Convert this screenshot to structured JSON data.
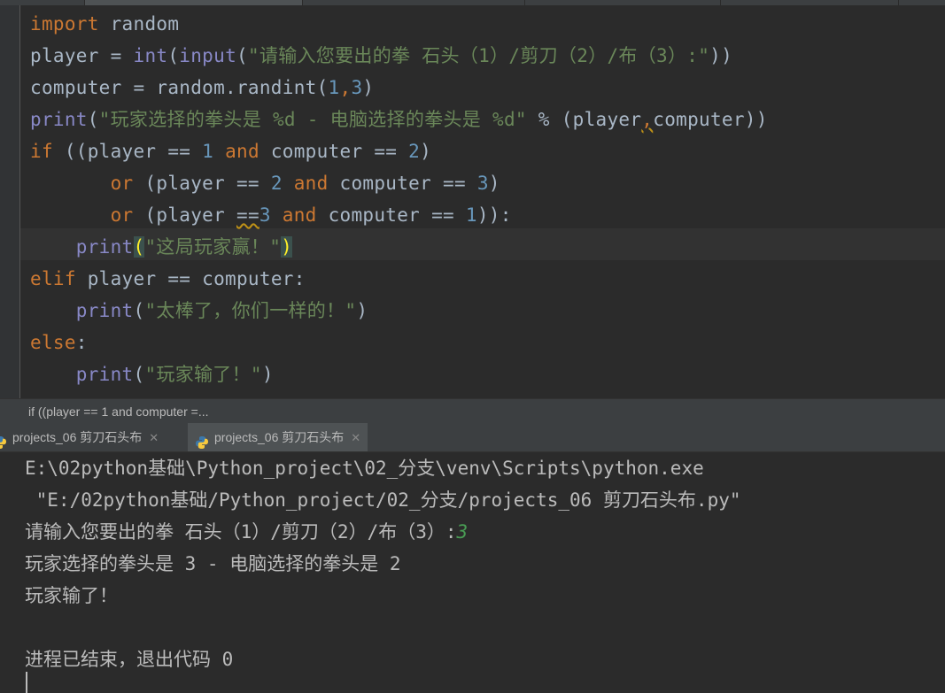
{
  "editor": {
    "lines": [
      {
        "tokens": [
          {
            "t": "import",
            "c": "kw"
          },
          {
            "t": " random",
            "c": "plain"
          }
        ]
      },
      {
        "tokens": [
          {
            "t": "player = ",
            "c": "plain"
          },
          {
            "t": "int",
            "c": "fn"
          },
          {
            "t": "(",
            "c": "plain"
          },
          {
            "t": "input",
            "c": "fn"
          },
          {
            "t": "(",
            "c": "plain"
          },
          {
            "t": "\"请输入您要出的拳 石头（1）/剪刀（2）/布（3）:\"",
            "c": "str"
          },
          {
            "t": "))",
            "c": "plain"
          }
        ]
      },
      {
        "tokens": [
          {
            "t": "computer = random.randint(",
            "c": "plain"
          },
          {
            "t": "1",
            "c": "num"
          },
          {
            "t": ",",
            "c": "kw"
          },
          {
            "t": "3",
            "c": "num"
          },
          {
            "t": ")",
            "c": "plain"
          }
        ]
      },
      {
        "tokens": [
          {
            "t": "print",
            "c": "fn"
          },
          {
            "t": "(",
            "c": "plain"
          },
          {
            "t": "\"玩家选择的拳头是 %d - 电脑选择的拳头是 %d\"",
            "c": "str"
          },
          {
            "t": " % (player",
            "c": "plain"
          },
          {
            "t": ",",
            "c": "kw warn"
          },
          {
            "t": "computer))",
            "c": "plain"
          }
        ]
      },
      {
        "tokens": [
          {
            "t": "if",
            "c": "kw"
          },
          {
            "t": " ((player == ",
            "c": "plain"
          },
          {
            "t": "1",
            "c": "num"
          },
          {
            "t": " ",
            "c": "plain"
          },
          {
            "t": "and",
            "c": "kw"
          },
          {
            "t": " computer == ",
            "c": "plain"
          },
          {
            "t": "2",
            "c": "num"
          },
          {
            "t": ")",
            "c": "plain"
          }
        ]
      },
      {
        "tokens": [
          {
            "t": "       ",
            "c": "plain"
          },
          {
            "t": "or",
            "c": "kw"
          },
          {
            "t": " (player == ",
            "c": "plain"
          },
          {
            "t": "2",
            "c": "num"
          },
          {
            "t": " ",
            "c": "plain"
          },
          {
            "t": "and",
            "c": "kw"
          },
          {
            "t": " computer == ",
            "c": "plain"
          },
          {
            "t": "3",
            "c": "num"
          },
          {
            "t": ")",
            "c": "plain"
          }
        ]
      },
      {
        "tokens": [
          {
            "t": "       ",
            "c": "plain"
          },
          {
            "t": "or",
            "c": "kw"
          },
          {
            "t": " (player ",
            "c": "plain"
          },
          {
            "t": "==",
            "c": "plain warn"
          },
          {
            "t": "3",
            "c": "num"
          },
          {
            "t": " ",
            "c": "plain"
          },
          {
            "t": "and",
            "c": "kw"
          },
          {
            "t": " computer == ",
            "c": "plain"
          },
          {
            "t": "1",
            "c": "num"
          },
          {
            "t": ")):",
            "c": "plain"
          }
        ]
      },
      {
        "tokens": [
          {
            "t": "    ",
            "c": "plain"
          },
          {
            "t": "print",
            "c": "fn"
          },
          {
            "t": "(",
            "c": "brace-match"
          },
          {
            "t": "\"这局玩家赢！\"",
            "c": "str"
          },
          {
            "t": ")",
            "c": "brace-match"
          }
        ]
      },
      {
        "tokens": [
          {
            "t": "elif",
            "c": "kw"
          },
          {
            "t": " player == computer:",
            "c": "plain"
          }
        ]
      },
      {
        "tokens": [
          {
            "t": "    ",
            "c": "plain"
          },
          {
            "t": "print",
            "c": "fn"
          },
          {
            "t": "(",
            "c": "plain"
          },
          {
            "t": "\"太棒了，你们一样的！\"",
            "c": "str"
          },
          {
            "t": ")",
            "c": "plain"
          }
        ]
      },
      {
        "tokens": [
          {
            "t": "else",
            "c": "kw"
          },
          {
            "t": ":",
            "c": "plain"
          }
        ]
      },
      {
        "tokens": [
          {
            "t": "    ",
            "c": "plain"
          },
          {
            "t": "print",
            "c": "fn"
          },
          {
            "t": "(",
            "c": "plain"
          },
          {
            "t": "\"玩家输了！\"",
            "c": "str"
          },
          {
            "t": ")",
            "c": "plain"
          }
        ]
      }
    ],
    "current_line_index": 7
  },
  "breadcrumb": "if ((player == 1 and computer =...",
  "run_tabs": [
    {
      "label": "projects_06 剪刀石头布",
      "active": false
    },
    {
      "label": "projects_06 剪刀石头布",
      "active": true
    }
  ],
  "console": {
    "lines": [
      {
        "text": "E:\\02python基础\\Python_project\\02_分支\\venv\\Scripts\\python.exe"
      },
      {
        "text": " \"E:/02python基础/Python_project/02_分支/projects_06 剪刀石头布.py\""
      },
      {
        "text": "请输入您要出的拳 石头（1）/剪刀（2）/布（3）:",
        "input": "3"
      },
      {
        "text": "玩家选择的拳头是 3 - 电脑选择的拳头是 2"
      },
      {
        "text": "玩家输了！"
      },
      {
        "text": ""
      },
      {
        "text": "进程已结束，退出代码 0"
      }
    ]
  },
  "colors": {
    "keyword": "#cc7832",
    "builtin": "#8888c6",
    "string": "#6a8759",
    "number": "#6897bb",
    "input_echo": "#499c54"
  }
}
